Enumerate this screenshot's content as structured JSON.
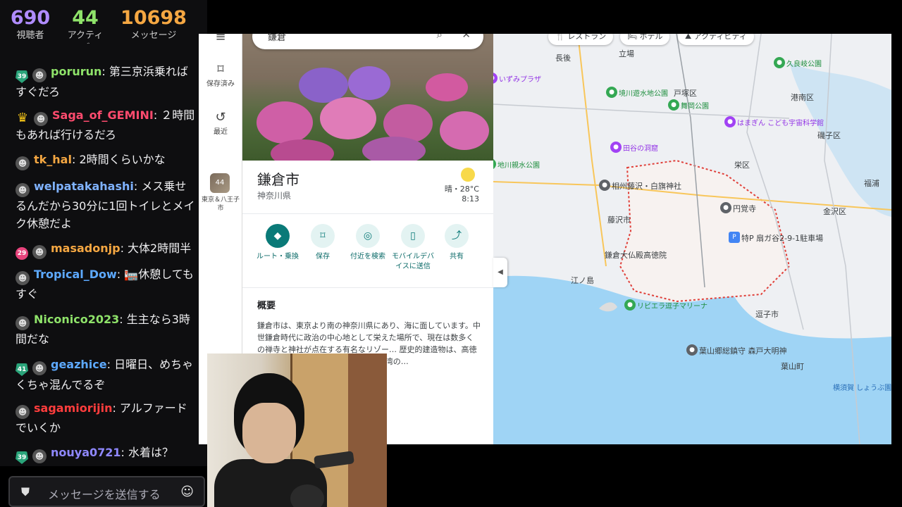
{
  "stats": {
    "viewers": {
      "value": "690",
      "label": "視聴者"
    },
    "active": {
      "value": "44",
      "label": "アクティブ"
    },
    "messages": {
      "value": "10698",
      "label": "メッセージ"
    }
  },
  "chat": [
    {
      "badge": "39",
      "user": "porurun",
      "color": "#8fe36a",
      "text": ": 第三京浜乗ればすぐだろ"
    },
    {
      "badge": "crown",
      "user": "Saga_of_GEMINI",
      "color": "#ff4b6e",
      "text": ": ２時間もあれば行けるだろ"
    },
    {
      "badge": "",
      "user": "tk_hal",
      "color": "#f5a742",
      "text": ": 2時間くらいかな"
    },
    {
      "badge": "",
      "user": "welpatakahashi",
      "color": "#7fb2ff",
      "text": ": メス乗せるんだから30分に1回トイレとメイク休憩だよ"
    },
    {
      "badge": "29",
      "user": "masadonjp",
      "color": "#f5a742",
      "text": ": 大体2時間半"
    },
    {
      "badge": "",
      "user": "Tropical_Dow",
      "color": "#5da9ff",
      "text": ": 🏣休憩してもすぐ"
    },
    {
      "badge": "",
      "user": "Niconico2023",
      "color": "#8fe36a",
      "text": ": 生主なら3時間だな"
    },
    {
      "badge": "41",
      "user": "geazhice",
      "color": "#5da9ff",
      "text": ": 日曜日、めちゃくちゃ混んでるぞ"
    },
    {
      "badge": "",
      "user": "sagamiorijin",
      "color": "#ff3d3d",
      "text": ": アルファードでいくか"
    },
    {
      "badge": "39",
      "user": "nouya0721",
      "color": "#8f88ff",
      "text": ": 水着は？"
    }
  ],
  "chat_input": {
    "placeholder": "メッセージを送信する"
  },
  "maps": {
    "search_query": "鎌倉",
    "rail": {
      "saved": "保存済み",
      "recent": "最近",
      "history_item": "東京＆八王子市",
      "history_badge": "44"
    },
    "place": {
      "title": "鎌倉市",
      "subtitle": "神奈川県",
      "weather": "晴・28°C",
      "time": "8:13"
    },
    "actions": [
      {
        "label": "ルート・乗換",
        "icon": "directions-icon"
      },
      {
        "label": "保存",
        "icon": "bookmark-icon"
      },
      {
        "label": "付近を検索",
        "icon": "nearby-icon"
      },
      {
        "label": "モバイルデバイスに送信",
        "icon": "send-to-phone-icon"
      },
      {
        "label": "共有",
        "icon": "share-icon"
      }
    ],
    "overview": {
      "heading": "概要",
      "text": "鎌倉市は、東京より南の神奈川県にあり、海に面しています。中世鎌倉時代に政治の中心地として栄えた場所で、現在は数多くの禅寺と神社が点在する有名なリゾー… 歴史的建造物は、高徳 …は高さが約 13 m もあ …た。相模湾の…"
    },
    "chips": [
      "レストラン",
      "ホテル",
      "アクティビティ"
    ],
    "map_labels": {
      "nagago": "長後",
      "tate": "立場",
      "izumi_plaza": "いずみプラザ",
      "sakai_park": "境川遊水地公園",
      "totsuka": "戸塚区",
      "maioka": "舞岡公園",
      "konan": "港南区",
      "kurami": "久良岐公園",
      "hamagin": "はまぎん こども宇宙科学館",
      "isogo": "磯子区",
      "taya": "田谷の洞窟",
      "sakae": "栄区",
      "jichikawa": "地川親水公園",
      "shirahata": "相州藤沢・白旗神社",
      "fujisawa": "藤沢市",
      "enkakuji": "円覚寺",
      "kanazawa": "金沢区",
      "fukura": "福浦",
      "parking": "特P 扇ガ谷2-9-1駐車場",
      "daibutsu": "鎌倉大仏殿高徳院",
      "enoshima": "江ノ島",
      "riviera": "リビエラ逗子マリーナ",
      "zushi": "逗子市",
      "hayama_shrine": "葉山郷総鎮守 森戸大明神",
      "hayama": "葉山町",
      "yokosuka": "横須賀 しょうぶ園"
    }
  }
}
